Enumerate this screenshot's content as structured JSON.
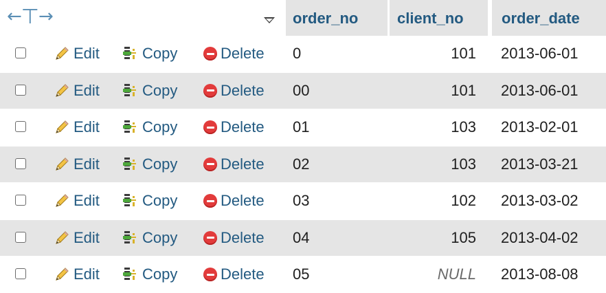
{
  "header": {
    "arrows_left": "←",
    "arrows_right": "→",
    "columns": [
      "order_no",
      "client_no",
      "order_date"
    ]
  },
  "actions": {
    "edit": "Edit",
    "copy": "Copy",
    "delete": "Delete"
  },
  "rows": [
    {
      "order_no": "0",
      "client_no": "101",
      "order_date": "2013-06-01"
    },
    {
      "order_no": "00",
      "client_no": "101",
      "order_date": "2013-06-01"
    },
    {
      "order_no": "01",
      "client_no": "103",
      "order_date": "2013-02-01"
    },
    {
      "order_no": "02",
      "client_no": "103",
      "order_date": "2013-03-21"
    },
    {
      "order_no": "03",
      "client_no": "102",
      "order_date": "2013-03-02"
    },
    {
      "order_no": "04",
      "client_no": "105",
      "order_date": "2013-04-02"
    },
    {
      "order_no": "05",
      "client_no": "NULL",
      "order_date": "2013-08-08"
    }
  ],
  "colors": {
    "link": "#235a81",
    "header_bg": "#e4e4e4",
    "row_alt_bg": "#e5e5e5",
    "delete_icon": "#e23b3b"
  }
}
